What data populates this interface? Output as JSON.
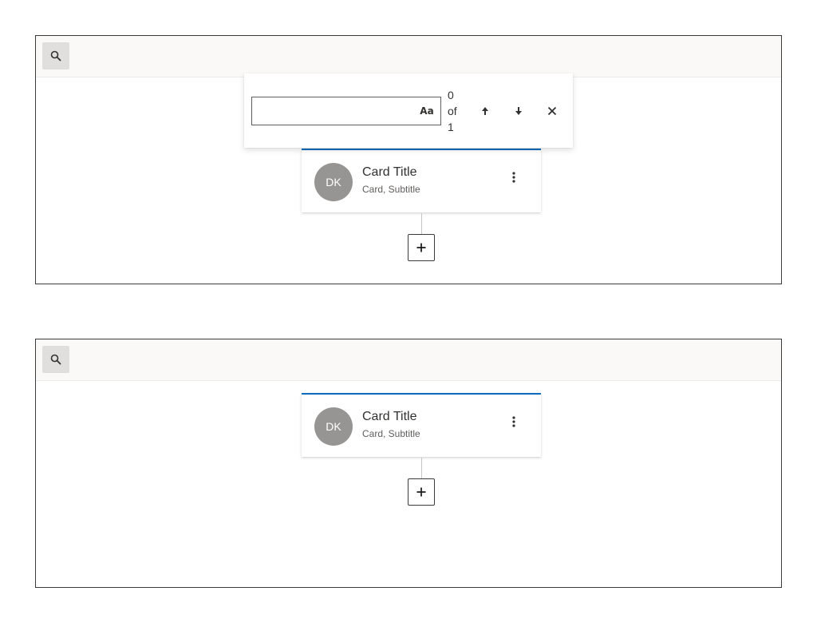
{
  "panels": [
    {
      "card": {
        "avatar_initials": "DK",
        "title": "Card Title",
        "subtitle": "Card, Subtitle"
      },
      "add_label": "+"
    },
    {
      "card": {
        "avatar_initials": "DK",
        "title": "Card Title",
        "subtitle": "Card, Subtitle"
      },
      "add_label": "+"
    }
  ],
  "find_bar": {
    "query": "",
    "match_case_label": "Aa",
    "count_current": "0",
    "count_of": "of",
    "count_total": "1"
  },
  "icons": [
    "search-icon",
    "more-vertical-icon",
    "arrow-up-icon",
    "arrow-down-icon",
    "close-icon",
    "plus-icon"
  ],
  "colors": {
    "accent": "#0f6cbd",
    "avatar": "#979593",
    "toolbar": "#faf9f8"
  }
}
